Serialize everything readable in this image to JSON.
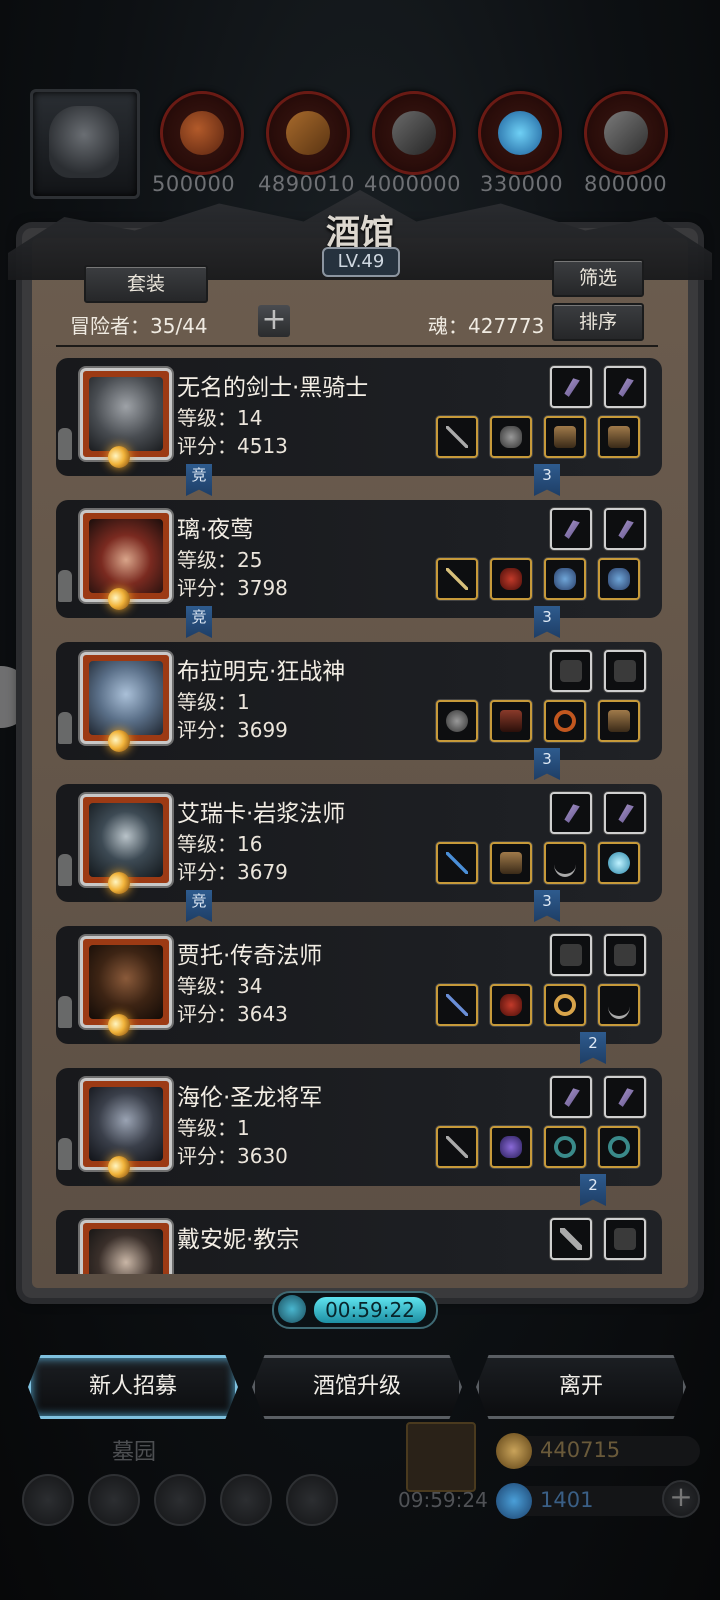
{
  "resources": {
    "values": [
      "500000",
      "4890010",
      "4000000",
      "330000",
      "800000"
    ],
    "icons": [
      "leather-icon",
      "wood-icon",
      "iron-icon",
      "crystal-icon",
      "steel-icon"
    ]
  },
  "panel": {
    "title": "酒馆",
    "level": "LV.49",
    "set_button": "套装",
    "filter_button": "筛选",
    "sort_button": "排序",
    "adventurers": "冒险者：35/44",
    "soul": "魂：427773"
  },
  "heroes": [
    {
      "name": "无名的剑士·黑骑士",
      "level": "等级：14",
      "score": "评分：4513",
      "left_tag": "竞",
      "right_tag": "3"
    },
    {
      "name": "璃·夜莺",
      "level": "等级：25",
      "score": "评分：3798",
      "left_tag": "竞",
      "right_tag": "3"
    },
    {
      "name": "布拉明克·狂战神",
      "level": "等级：1",
      "score": "评分：3699",
      "left_tag": "",
      "right_tag": "3"
    },
    {
      "name": "艾瑞卡·岩浆法师",
      "level": "等级：16",
      "score": "评分：3679",
      "left_tag": "竞",
      "right_tag": "3"
    },
    {
      "name": "贾托·传奇法师",
      "level": "等级：34",
      "score": "评分：3643",
      "left_tag": "",
      "right_tag": "2"
    },
    {
      "name": "海伦·圣龙将军",
      "level": "等级：1",
      "score": "评分：3630",
      "left_tag": "",
      "right_tag": "2"
    },
    {
      "name": "戴安妮·教宗",
      "level": "",
      "score": "",
      "left_tag": "",
      "right_tag": ""
    }
  ],
  "timer": "00:59:22",
  "buttons": {
    "recruit": "新人招募",
    "upgrade": "酒馆升级",
    "leave": "离开"
  },
  "bottom": {
    "tomb_label": "墓园",
    "gift_timer": "09:59:24",
    "gold": "440715",
    "gems": "1401"
  }
}
